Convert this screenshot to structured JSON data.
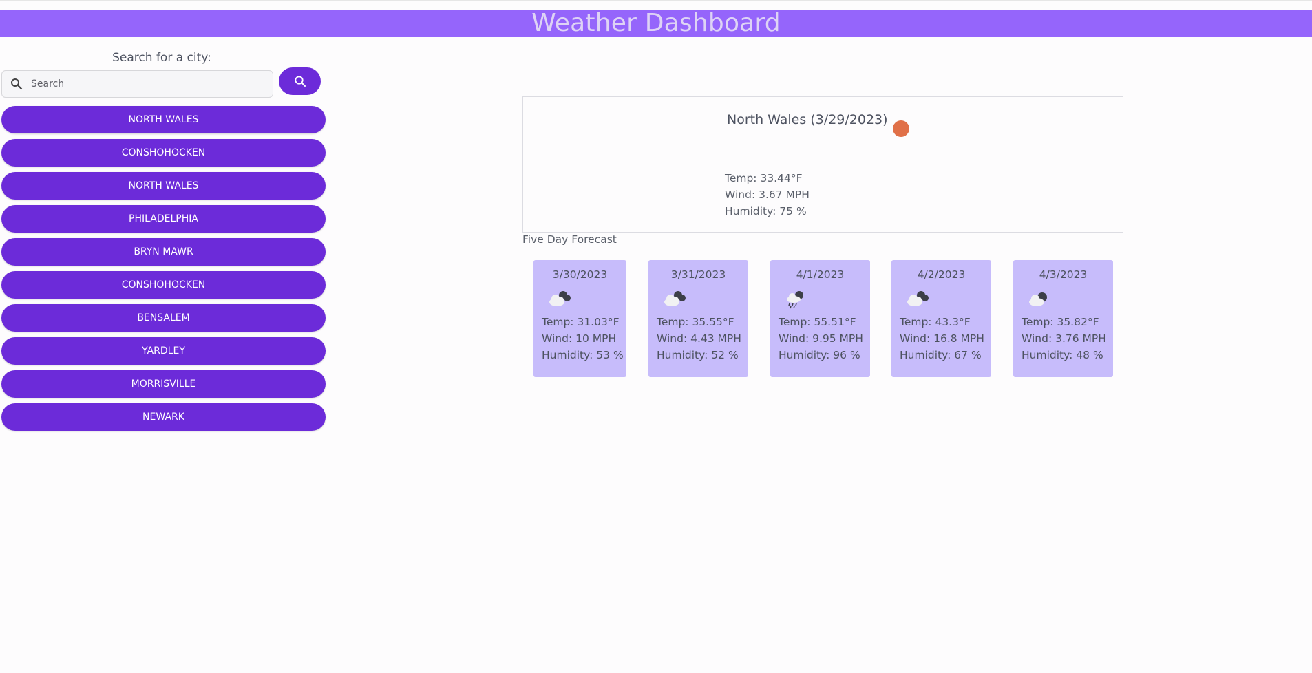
{
  "header": {
    "title": "Weather Dashboard"
  },
  "sidebar": {
    "search_label": "Search for a city:",
    "search_placeholder": "Search",
    "search_value": "",
    "cities": [
      "North Wales",
      "Conshohocken",
      "North Wales",
      "Philadelphia",
      "Bryn Mawr",
      "Conshohocken",
      "Bensalem",
      "Yardley",
      "Morrisville",
      "Newark"
    ]
  },
  "current": {
    "title": "North Wales (3/29/2023)",
    "icon": "weather-status-icon",
    "temp": "Temp: 33.44°F",
    "wind": "Wind: 3.67 MPH",
    "humidity": "Humidity: 75 %"
  },
  "forecast": {
    "title": "Five Day Forecast",
    "days": [
      {
        "date": "3/30/2023",
        "icon": "broken-clouds-icon",
        "temp": "Temp: 31.03°F",
        "wind": "Wind: 10 MPH",
        "humidity": "Humidity: 53 %"
      },
      {
        "date": "3/31/2023",
        "icon": "broken-clouds-icon",
        "temp": "Temp: 35.55°F",
        "wind": "Wind: 4.43 MPH",
        "humidity": "Humidity: 52 %"
      },
      {
        "date": "4/1/2023",
        "icon": "rain-cloud-icon",
        "temp": "Temp: 55.51°F",
        "wind": "Wind: 9.95 MPH",
        "humidity": "Humidity: 96 %"
      },
      {
        "date": "4/2/2023",
        "icon": "broken-clouds-icon",
        "temp": "Temp: 43.3°F",
        "wind": "Wind: 16.8 MPH",
        "humidity": "Humidity: 67 %"
      },
      {
        "date": "4/3/2023",
        "icon": "scattered-clouds-icon",
        "temp": "Temp: 35.82°F",
        "wind": "Wind: 3.76 MPH",
        "humidity": "Humidity: 48 %"
      }
    ]
  },
  "colors": {
    "header_bg": "#9565fb",
    "header_text": "#ded3f5",
    "button_bg": "#6c2bd9",
    "card_bg": "#c7bcfb",
    "weather_dot": "#e07048"
  }
}
